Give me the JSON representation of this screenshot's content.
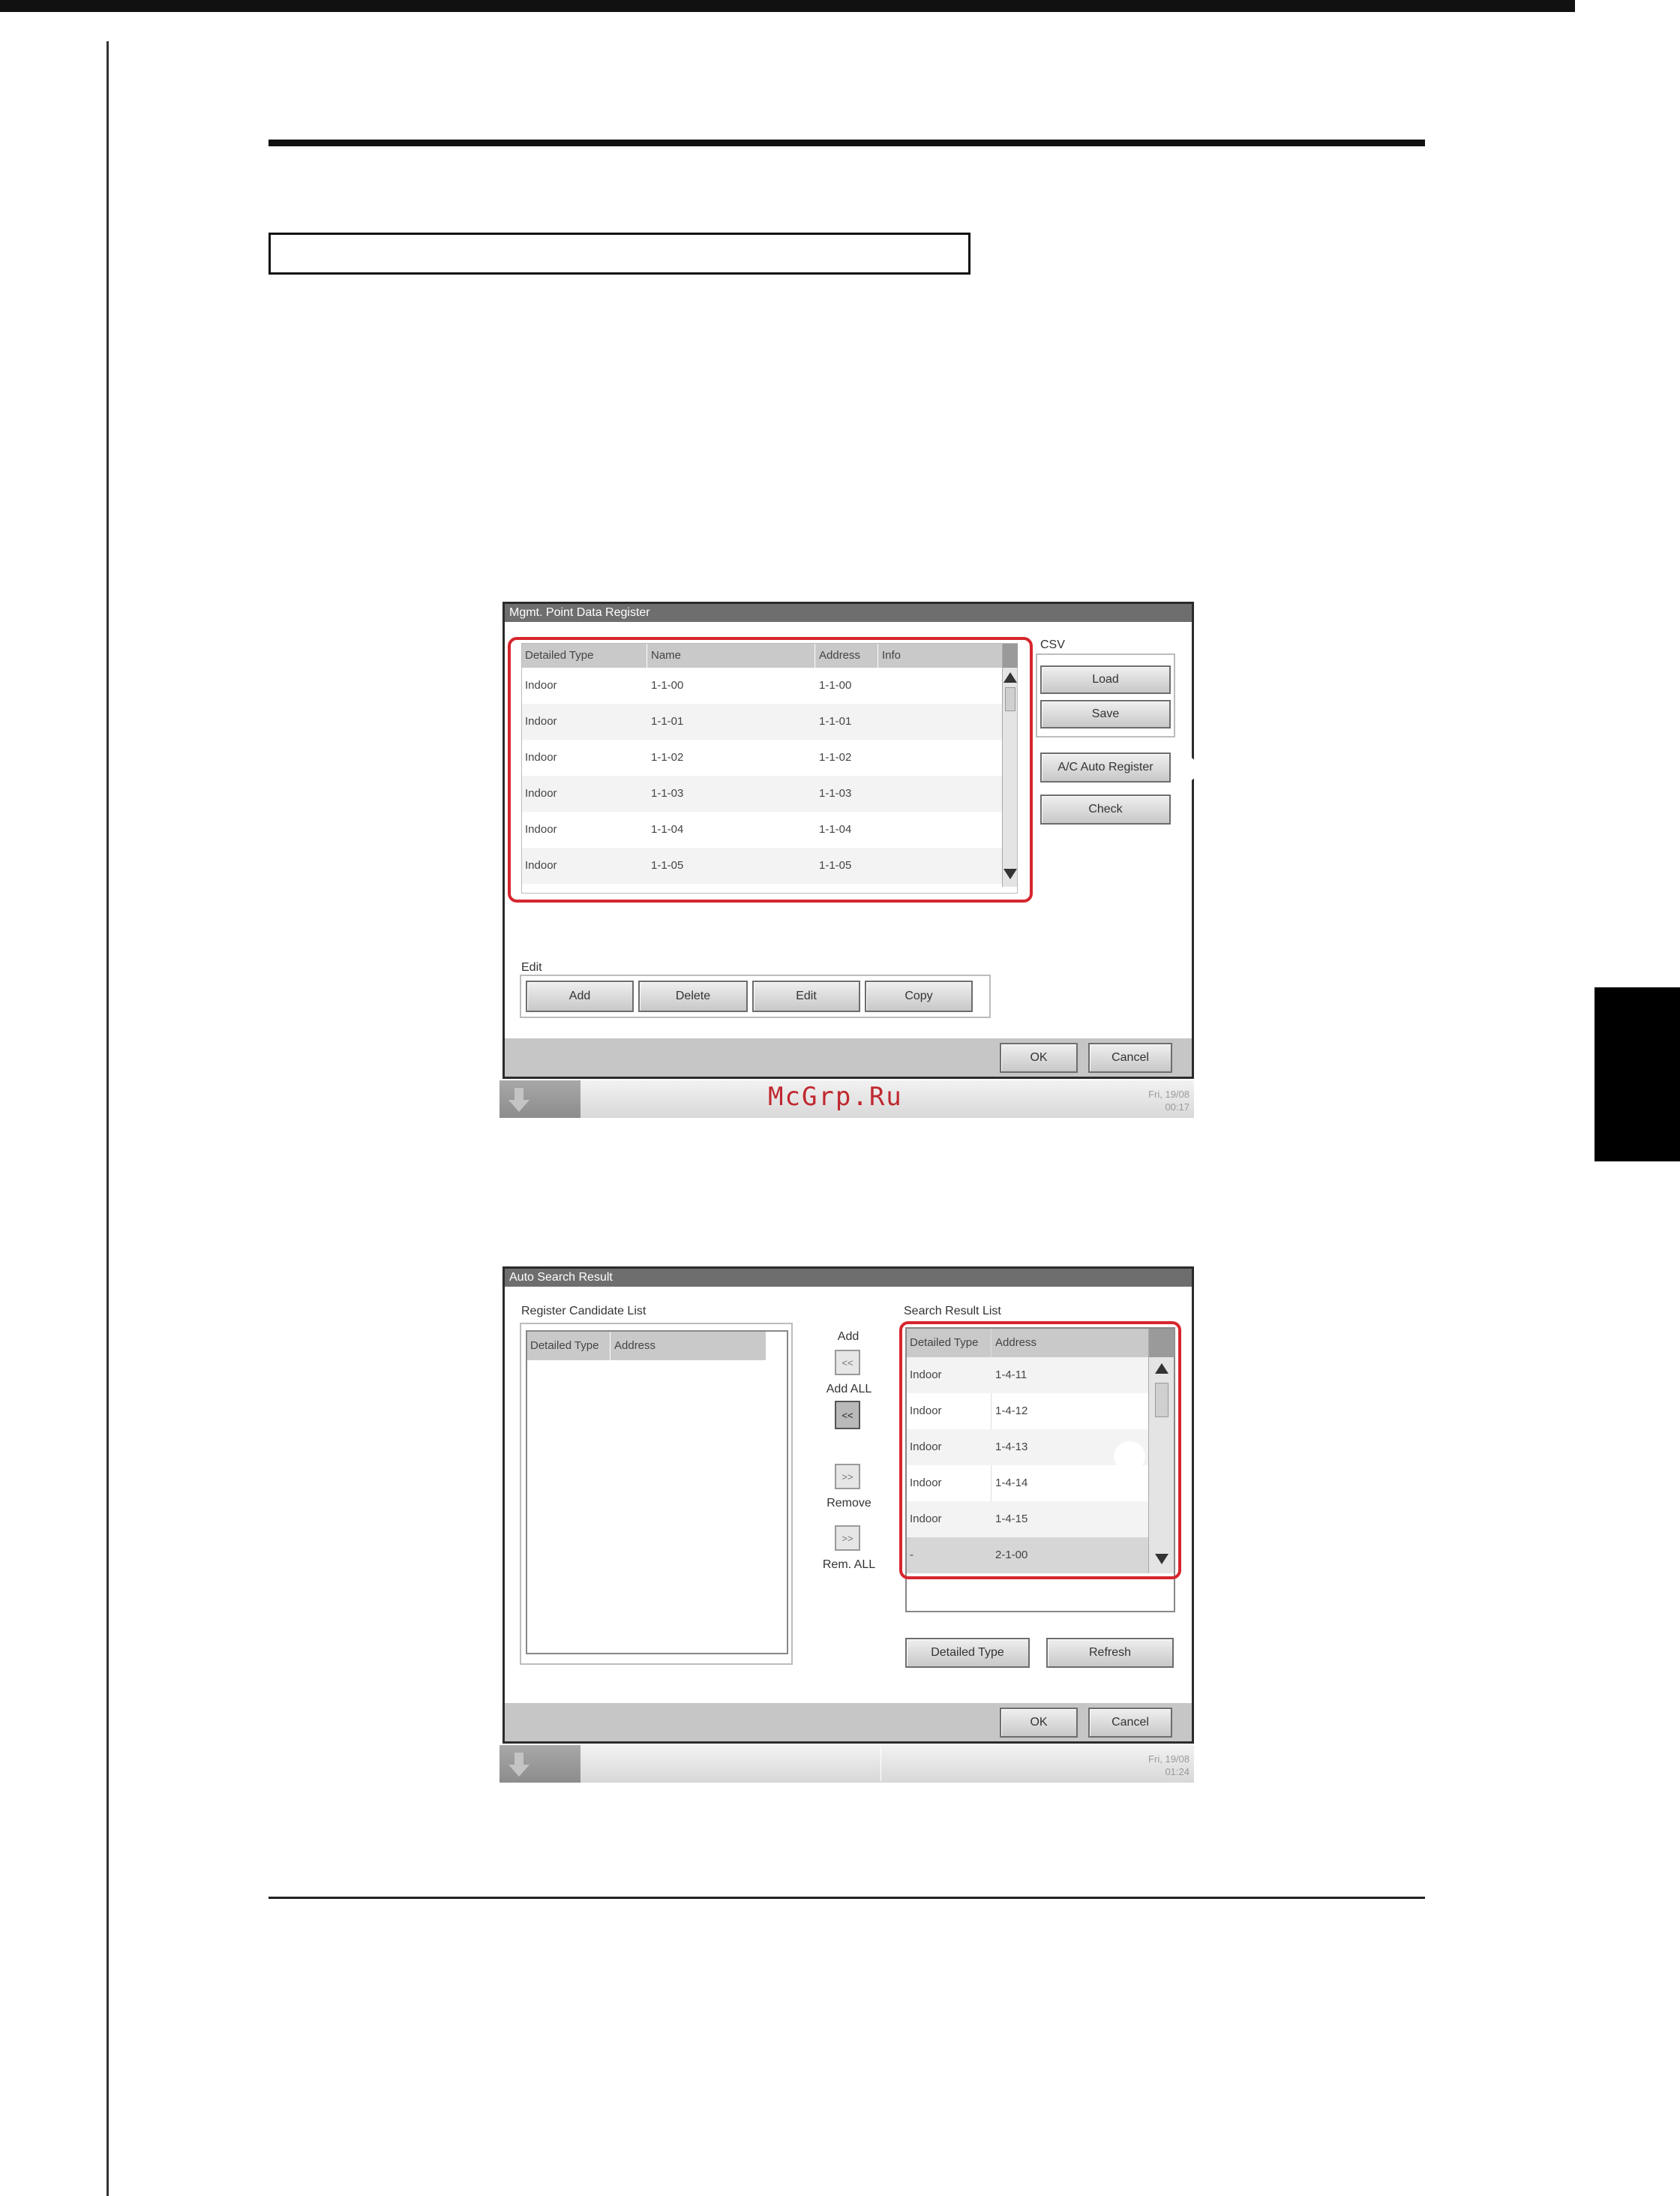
{
  "screen1": {
    "title": "Mgmt. Point Data Register",
    "columns": [
      "Detailed Type",
      "Name",
      "Address",
      "Info"
    ],
    "rows": [
      {
        "type": "Indoor",
        "name": "1-1-00",
        "address": "1-1-00",
        "info": ""
      },
      {
        "type": "Indoor",
        "name": "1-1-01",
        "address": "1-1-01",
        "info": ""
      },
      {
        "type": "Indoor",
        "name": "1-1-02",
        "address": "1-1-02",
        "info": ""
      },
      {
        "type": "Indoor",
        "name": "1-1-03",
        "address": "1-1-03",
        "info": ""
      },
      {
        "type": "Indoor",
        "name": "1-1-04",
        "address": "1-1-04",
        "info": ""
      },
      {
        "type": "Indoor",
        "name": "1-1-05",
        "address": "1-1-05",
        "info": ""
      }
    ],
    "csv_label": "CSV",
    "load_button": "Load",
    "save_button": "Save",
    "auto_register_button": "A/C Auto Register",
    "check_button": "Check",
    "edit_label": "Edit",
    "add_button": "Add",
    "delete_button": "Delete",
    "edit_button": "Edit",
    "copy_button": "Copy",
    "ok_button": "OK",
    "cancel_button": "Cancel",
    "status_date": "Fri, 19/08",
    "status_time": "00:17",
    "watermark": "McGrp.Ru"
  },
  "screen2": {
    "title": "Auto Search Result",
    "candidate_label": "Register Candidate List",
    "candidate_columns": [
      "Detailed Type",
      "Address"
    ],
    "add_label": "Add",
    "add_all_label": "Add ALL",
    "remove_label": "Remove",
    "remove_all_label": "Rem. ALL",
    "add_arrow": "<<",
    "add_all_arrow": "<<",
    "remove_arrow": ">>",
    "remove_all_arrow": ">>",
    "result_label": "Search Result List",
    "result_columns": [
      "Detailed Type",
      "Address"
    ],
    "results": [
      {
        "type": "Indoor",
        "address": "1-4-11"
      },
      {
        "type": "Indoor",
        "address": "1-4-12"
      },
      {
        "type": "Indoor",
        "address": "1-4-13"
      },
      {
        "type": "Indoor",
        "address": "1-4-14"
      },
      {
        "type": "Indoor",
        "address": "1-4-15"
      },
      {
        "type": "-",
        "address": "2-1-00"
      }
    ],
    "detailed_type_button": "Detailed Type",
    "refresh_button": "Refresh",
    "ok_button": "OK",
    "cancel_button": "Cancel",
    "status_date": "Fri, 19/08",
    "status_time": "01:24"
  }
}
